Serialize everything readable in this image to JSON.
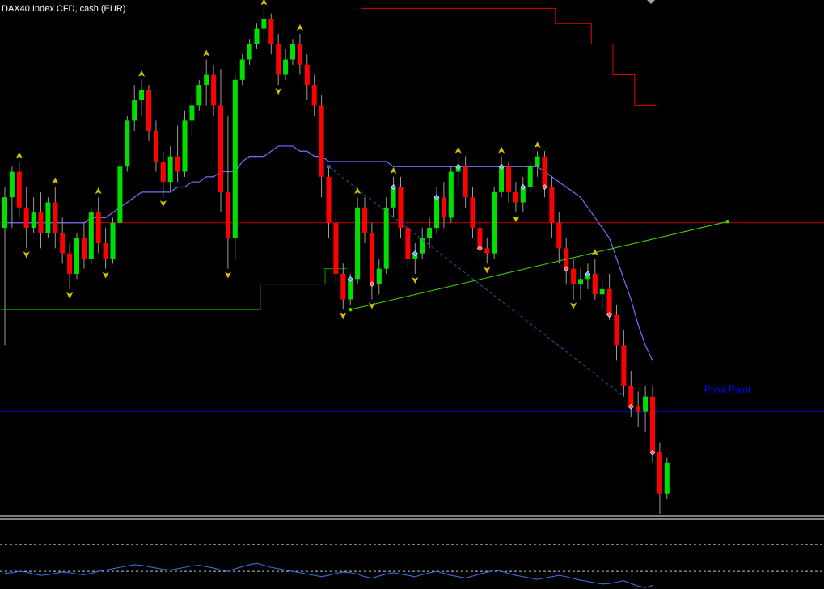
{
  "symbol_title": "DAX40 Index CFD, cash (EUR)",
  "pivot_label": "Pivot Point",
  "colors": {
    "background": "#000000",
    "bull": "#00e000",
    "bear": "#ff0000",
    "wick": "#9a9a9a",
    "ma_line": "#7070ff",
    "stop_upper": "#e00000",
    "stop_lower": "#00a000",
    "h_line_yellow": "#a0ff00",
    "h_line_red": "#c00000",
    "pivot_line": "#0000d0",
    "pivot_text": "#0000ff",
    "trend_line": "#40e000",
    "zigzag": "#3050a0",
    "fractal": "#d4c000",
    "oscillator": "#3a78e8",
    "separator": "#ffffff",
    "title_text": "#ffffff"
  },
  "chart_data": {
    "type": "candlestick",
    "title": "DAX40 Index CFD, cash (EUR)",
    "price_range": [
      0,
      100
    ],
    "grid": false,
    "legend": "none",
    "candles": [
      {
        "o": 56,
        "h": 64,
        "l": 33,
        "c": 62
      },
      {
        "o": 62,
        "h": 68,
        "l": 56,
        "c": 67
      },
      {
        "o": 67,
        "h": 69,
        "l": 58,
        "c": 60
      },
      {
        "o": 60,
        "h": 64,
        "l": 52,
        "c": 56
      },
      {
        "o": 56,
        "h": 62,
        "l": 55,
        "c": 59
      },
      {
        "o": 59,
        "h": 63,
        "l": 52,
        "c": 55
      },
      {
        "o": 55,
        "h": 62,
        "l": 54,
        "c": 61
      },
      {
        "o": 61,
        "h": 64,
        "l": 52,
        "c": 55
      },
      {
        "o": 55,
        "h": 58,
        "l": 49,
        "c": 51
      },
      {
        "o": 51,
        "h": 53,
        "l": 44,
        "c": 47
      },
      {
        "o": 47,
        "h": 55,
        "l": 46,
        "c": 54
      },
      {
        "o": 54,
        "h": 57,
        "l": 48,
        "c": 50
      },
      {
        "o": 50,
        "h": 60,
        "l": 49,
        "c": 59
      },
      {
        "o": 59,
        "h": 62,
        "l": 51,
        "c": 53
      },
      {
        "o": 53,
        "h": 56,
        "l": 48,
        "c": 50
      },
      {
        "o": 50,
        "h": 58,
        "l": 49,
        "c": 57
      },
      {
        "o": 57,
        "h": 69,
        "l": 56,
        "c": 68
      },
      {
        "o": 68,
        "h": 78,
        "l": 67,
        "c": 77
      },
      {
        "o": 77,
        "h": 84,
        "l": 75,
        "c": 81
      },
      {
        "o": 81,
        "h": 85,
        "l": 78,
        "c": 83
      },
      {
        "o": 83,
        "h": 84,
        "l": 73,
        "c": 75
      },
      {
        "o": 75,
        "h": 77,
        "l": 67,
        "c": 69
      },
      {
        "o": 69,
        "h": 71,
        "l": 62,
        "c": 65
      },
      {
        "o": 65,
        "h": 72,
        "l": 63,
        "c": 70
      },
      {
        "o": 70,
        "h": 76,
        "l": 65,
        "c": 67
      },
      {
        "o": 67,
        "h": 79,
        "l": 66,
        "c": 77
      },
      {
        "o": 77,
        "h": 82,
        "l": 74,
        "c": 80
      },
      {
        "o": 80,
        "h": 85,
        "l": 79,
        "c": 84
      },
      {
        "o": 84,
        "h": 89,
        "l": 80,
        "c": 86
      },
      {
        "o": 86,
        "h": 88,
        "l": 78,
        "c": 80
      },
      {
        "o": 80,
        "h": 87,
        "l": 59,
        "c": 63
      },
      {
        "o": 63,
        "h": 78,
        "l": 48,
        "c": 54
      },
      {
        "o": 54,
        "h": 86,
        "l": 50,
        "c": 85
      },
      {
        "o": 85,
        "h": 90,
        "l": 84,
        "c": 89
      },
      {
        "o": 89,
        "h": 93,
        "l": 88,
        "c": 92
      },
      {
        "o": 92,
        "h": 96,
        "l": 91,
        "c": 95
      },
      {
        "o": 95,
        "h": 99,
        "l": 93,
        "c": 97
      },
      {
        "o": 97,
        "h": 98,
        "l": 90,
        "c": 92
      },
      {
        "o": 92,
        "h": 94,
        "l": 84,
        "c": 86
      },
      {
        "o": 86,
        "h": 91,
        "l": 85,
        "c": 89
      },
      {
        "o": 89,
        "h": 93,
        "l": 88,
        "c": 92
      },
      {
        "o": 92,
        "h": 94,
        "l": 86,
        "c": 88
      },
      {
        "o": 88,
        "h": 90,
        "l": 81,
        "c": 84
      },
      {
        "o": 84,
        "h": 86,
        "l": 78,
        "c": 80
      },
      {
        "o": 80,
        "h": 82,
        "l": 62,
        "c": 66
      },
      {
        "o": 66,
        "h": 68,
        "l": 54,
        "c": 57
      },
      {
        "o": 57,
        "h": 59,
        "l": 45,
        "c": 47
      },
      {
        "o": 47,
        "h": 49,
        "l": 40,
        "c": 42
      },
      {
        "o": 42,
        "h": 47,
        "l": 41,
        "c": 46
      },
      {
        "o": 46,
        "h": 62,
        "l": 45,
        "c": 60
      },
      {
        "o": 60,
        "h": 62,
        "l": 53,
        "c": 55
      },
      {
        "o": 55,
        "h": 57,
        "l": 42,
        "c": 45
      },
      {
        "o": 45,
        "h": 50,
        "l": 43,
        "c": 48
      },
      {
        "o": 48,
        "h": 62,
        "l": 47,
        "c": 60
      },
      {
        "o": 60,
        "h": 66,
        "l": 58,
        "c": 64
      },
      {
        "o": 64,
        "h": 66,
        "l": 54,
        "c": 56
      },
      {
        "o": 56,
        "h": 58,
        "l": 48,
        "c": 50
      },
      {
        "o": 50,
        "h": 53,
        "l": 47,
        "c": 51
      },
      {
        "o": 51,
        "h": 56,
        "l": 50,
        "c": 54
      },
      {
        "o": 54,
        "h": 58,
        "l": 52,
        "c": 56
      },
      {
        "o": 56,
        "h": 64,
        "l": 55,
        "c": 62
      },
      {
        "o": 62,
        "h": 65,
        "l": 56,
        "c": 58
      },
      {
        "o": 58,
        "h": 68,
        "l": 57,
        "c": 67
      },
      {
        "o": 67,
        "h": 70,
        "l": 64,
        "c": 68
      },
      {
        "o": 68,
        "h": 70,
        "l": 60,
        "c": 62
      },
      {
        "o": 62,
        "h": 64,
        "l": 54,
        "c": 56
      },
      {
        "o": 56,
        "h": 58,
        "l": 50,
        "c": 52
      },
      {
        "o": 52,
        "h": 54,
        "l": 49,
        "c": 51
      },
      {
        "o": 51,
        "h": 64,
        "l": 50,
        "c": 63
      },
      {
        "o": 63,
        "h": 70,
        "l": 62,
        "c": 68
      },
      {
        "o": 68,
        "h": 69,
        "l": 61,
        "c": 63
      },
      {
        "o": 63,
        "h": 65,
        "l": 59,
        "c": 61
      },
      {
        "o": 61,
        "h": 66,
        "l": 59,
        "c": 64
      },
      {
        "o": 64,
        "h": 69,
        "l": 63,
        "c": 68
      },
      {
        "o": 68,
        "h": 71,
        "l": 66,
        "c": 70
      },
      {
        "o": 70,
        "h": 71,
        "l": 62,
        "c": 64
      },
      {
        "o": 64,
        "h": 66,
        "l": 54,
        "c": 57
      },
      {
        "o": 57,
        "h": 59,
        "l": 49,
        "c": 52
      },
      {
        "o": 52,
        "h": 54,
        "l": 45,
        "c": 48
      },
      {
        "o": 48,
        "h": 50,
        "l": 42,
        "c": 45
      },
      {
        "o": 45,
        "h": 48,
        "l": 42,
        "c": 46
      },
      {
        "o": 46,
        "h": 49,
        "l": 44,
        "c": 47
      },
      {
        "o": 47,
        "h": 50,
        "l": 42,
        "c": 43
      },
      {
        "o": 43,
        "h": 46,
        "l": 40,
        "c": 44
      },
      {
        "o": 44,
        "h": 47,
        "l": 38,
        "c": 39
      },
      {
        "o": 39,
        "h": 41,
        "l": 30,
        "c": 33
      },
      {
        "o": 33,
        "h": 36,
        "l": 23,
        "c": 25
      },
      {
        "o": 25,
        "h": 28,
        "l": 19,
        "c": 21
      },
      {
        "o": 21,
        "h": 24,
        "l": 17,
        "c": 20
      },
      {
        "o": 20,
        "h": 25,
        "l": 16,
        "c": 23
      },
      {
        "o": 23,
        "h": 25,
        "l": 10,
        "c": 12
      },
      {
        "o": 12,
        "h": 14,
        "l": 0,
        "c": 4
      },
      {
        "o": 4,
        "h": 11,
        "l": 3,
        "c": 10
      }
    ],
    "ma_series": [
      57,
      57,
      57,
      57,
      57,
      57,
      57,
      57,
      57,
      57,
      57,
      57,
      58,
      58,
      58,
      59,
      60,
      61,
      62,
      63,
      63,
      63,
      63,
      63,
      64,
      64,
      65,
      65,
      66,
      66,
      67,
      67,
      67,
      69,
      70,
      70,
      70,
      71,
      72,
      72,
      72,
      71,
      71,
      70,
      70,
      69,
      69,
      69,
      69,
      69,
      69,
      69,
      69,
      69,
      68,
      68,
      68,
      68,
      68,
      68,
      68,
      68,
      68,
      68,
      68,
      68,
      68,
      68,
      68,
      68,
      68,
      68,
      68,
      68,
      68,
      67,
      66,
      65,
      64,
      63,
      62,
      60,
      58,
      56,
      54,
      50,
      46,
      42,
      37,
      33,
      30
    ],
    "stop_upper": [
      null,
      null,
      null,
      null,
      null,
      null,
      null,
      null,
      null,
      null,
      null,
      null,
      null,
      null,
      null,
      null,
      null,
      null,
      null,
      null,
      null,
      null,
      null,
      null,
      null,
      null,
      null,
      null,
      null,
      null,
      null,
      null,
      null,
      null,
      null,
      null,
      null,
      null,
      null,
      null,
      null,
      null,
      null,
      null,
      null,
      null,
      null,
      null,
      null,
      null,
      99,
      99,
      99,
      99,
      99,
      99,
      99,
      99,
      99,
      99,
      99,
      99,
      99,
      99,
      99,
      99,
      99,
      99,
      99,
      99,
      99,
      99,
      99,
      99,
      99,
      99,
      99,
      96,
      96,
      96,
      96,
      96,
      92,
      92,
      92,
      86,
      86,
      86,
      80,
      80,
      80
    ],
    "stop_lower": [
      40,
      40,
      40,
      40,
      40,
      40,
      40,
      40,
      40,
      40,
      40,
      40,
      40,
      40,
      40,
      40,
      40,
      40,
      40,
      40,
      40,
      40,
      40,
      40,
      40,
      40,
      40,
      40,
      40,
      40,
      40,
      40,
      40,
      40,
      40,
      40,
      45,
      45,
      45,
      45,
      45,
      45,
      45,
      45,
      45,
      48,
      48,
      48,
      null,
      null,
      null,
      null,
      null,
      null,
      null,
      null,
      null,
      null,
      null,
      null,
      null,
      null,
      null,
      null,
      null,
      null,
      null,
      null,
      null,
      null,
      null,
      null,
      null,
      null,
      null,
      null,
      null,
      null,
      null,
      null,
      null,
      null,
      null,
      null,
      null,
      null,
      null,
      null,
      null,
      null,
      null
    ],
    "horizontal_levels": [
      {
        "name": "yellow_level",
        "value": 64
      },
      {
        "name": "red_level",
        "value": 57
      },
      {
        "name": "pivot_point",
        "value": 20
      }
    ],
    "oscillator": {
      "range": [
        0,
        100
      ],
      "levels": [
        70,
        30
      ],
      "values": [
        45,
        46,
        48,
        47,
        44,
        42,
        43,
        45,
        47,
        46,
        44,
        43,
        45,
        48,
        50,
        52,
        54,
        56,
        58,
        57,
        55,
        53,
        51,
        50,
        52,
        54,
        56,
        57,
        55,
        53,
        50,
        48,
        52,
        55,
        58,
        60,
        57,
        54,
        52,
        50,
        48,
        46,
        44,
        42,
        40,
        42,
        45,
        47,
        46,
        44,
        40,
        38,
        41,
        44,
        46,
        44,
        42,
        40,
        43,
        46,
        48,
        45,
        42,
        40,
        38,
        41,
        44,
        47,
        50,
        48,
        45,
        42,
        40,
        38,
        36,
        38,
        40,
        42,
        40,
        37,
        35,
        33,
        31,
        29,
        30,
        32,
        34,
        30,
        26,
        24,
        27
      ]
    }
  }
}
